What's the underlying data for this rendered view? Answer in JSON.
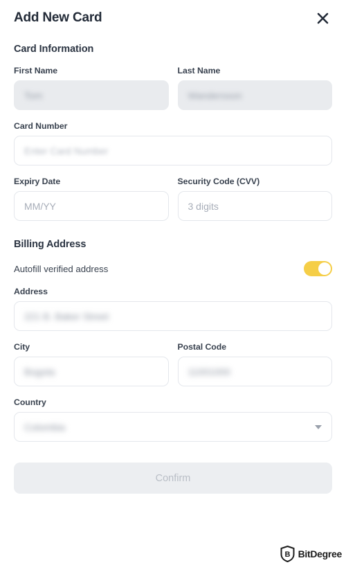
{
  "header": {
    "title": "Add New Card",
    "close_icon": "close-icon"
  },
  "sections": {
    "card_information": "Card Information",
    "billing_address": "Billing Address"
  },
  "fields": {
    "first_name": {
      "label": "First Name",
      "value": "Tom",
      "redacted": true
    },
    "last_name": {
      "label": "Last Name",
      "value": "Wandersson",
      "redacted": true
    },
    "card_number": {
      "label": "Card Number",
      "placeholder": "Enter Card Number",
      "redacted": true
    },
    "expiry_date": {
      "label": "Expiry Date",
      "placeholder": "MM/YY"
    },
    "security_code": {
      "label": "Security Code (CVV)",
      "placeholder": "3 digits"
    },
    "address": {
      "label": "Address",
      "value": "221 B. Baker Street",
      "redacted": true
    },
    "city": {
      "label": "City",
      "value": "Bogota",
      "redacted": true
    },
    "postal_code": {
      "label": "Postal Code",
      "value": "11001000",
      "redacted": true
    },
    "country": {
      "label": "Country",
      "value": "Colombia",
      "redacted": true,
      "caret_icon": "chevron-down-icon"
    }
  },
  "autofill": {
    "label": "Autofill verified address",
    "state": "on"
  },
  "actions": {
    "confirm": "Confirm",
    "confirm_enabled": false
  },
  "watermark": {
    "text": "BitDegree",
    "badge_letter": "B"
  },
  "colors": {
    "accent_toggle": "#F5CE47",
    "title": "#222A37",
    "label": "#39424F",
    "field_border": "#E4E7EC",
    "field_filled_bg": "#E9EBEE",
    "confirm_bg": "#ECEEF1",
    "confirm_text": "#B9BEC6",
    "placeholder": "#A7ADB8"
  }
}
